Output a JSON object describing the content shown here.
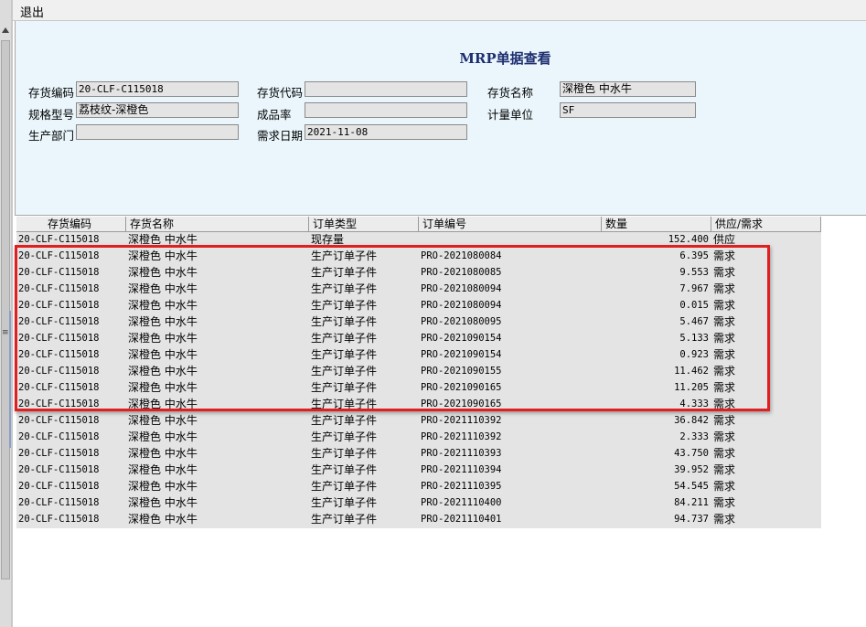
{
  "menu": {
    "exit_label": "退出"
  },
  "form": {
    "title": "MRP单据查看",
    "fields": {
      "inv_code_label": "存货编码",
      "inv_code_value": "20-CLF-C115018",
      "inv_alias_label": "存货代码",
      "inv_alias_value": "",
      "inv_name_label": "存货名称",
      "inv_name_value": "深橙色 中水牛",
      "spec_label": "规格型号",
      "spec_value": "荔枝纹-深橙色",
      "yield_label": "成品率",
      "yield_value": "",
      "unit_label": "计量单位",
      "unit_value": "SF",
      "dept_label": "生产部门",
      "dept_value": "",
      "date_label": "需求日期",
      "date_value": "2021-11-08"
    }
  },
  "grid": {
    "headers": [
      "存货编码",
      "存货名称",
      "订单类型",
      "订单编号",
      "数量",
      "供应/需求"
    ],
    "rows": [
      {
        "code": "20-CLF-C115018",
        "name": "深橙色 中水牛",
        "type": "现存量",
        "order": "",
        "qty": "152.400",
        "sd": "供应"
      },
      {
        "code": "20-CLF-C115018",
        "name": "深橙色 中水牛",
        "type": "生产订单子件",
        "order": "PRO-2021080084",
        "qty": "6.395",
        "sd": "需求"
      },
      {
        "code": "20-CLF-C115018",
        "name": "深橙色 中水牛",
        "type": "生产订单子件",
        "order": "PRO-2021080085",
        "qty": "9.553",
        "sd": "需求"
      },
      {
        "code": "20-CLF-C115018",
        "name": "深橙色 中水牛",
        "type": "生产订单子件",
        "order": "PRO-2021080094",
        "qty": "7.967",
        "sd": "需求"
      },
      {
        "code": "20-CLF-C115018",
        "name": "深橙色 中水牛",
        "type": "生产订单子件",
        "order": "PRO-2021080094",
        "qty": "0.015",
        "sd": "需求"
      },
      {
        "code": "20-CLF-C115018",
        "name": "深橙色 中水牛",
        "type": "生产订单子件",
        "order": "PRO-2021080095",
        "qty": "5.467",
        "sd": "需求"
      },
      {
        "code": "20-CLF-C115018",
        "name": "深橙色 中水牛",
        "type": "生产订单子件",
        "order": "PRO-2021090154",
        "qty": "5.133",
        "sd": "需求"
      },
      {
        "code": "20-CLF-C115018",
        "name": "深橙色 中水牛",
        "type": "生产订单子件",
        "order": "PRO-2021090154",
        "qty": "0.923",
        "sd": "需求"
      },
      {
        "code": "20-CLF-C115018",
        "name": "深橙色 中水牛",
        "type": "生产订单子件",
        "order": "PRO-2021090155",
        "qty": "11.462",
        "sd": "需求"
      },
      {
        "code": "20-CLF-C115018",
        "name": "深橙色 中水牛",
        "type": "生产订单子件",
        "order": "PRO-2021090165",
        "qty": "11.205",
        "sd": "需求"
      },
      {
        "code": "20-CLF-C115018",
        "name": "深橙色 中水牛",
        "type": "生产订单子件",
        "order": "PRO-2021090165",
        "qty": "4.333",
        "sd": "需求"
      },
      {
        "code": "20-CLF-C115018",
        "name": "深橙色 中水牛",
        "type": "生产订单子件",
        "order": "PRO-2021110392",
        "qty": "36.842",
        "sd": "需求"
      },
      {
        "code": "20-CLF-C115018",
        "name": "深橙色 中水牛",
        "type": "生产订单子件",
        "order": "PRO-2021110392",
        "qty": "2.333",
        "sd": "需求"
      },
      {
        "code": "20-CLF-C115018",
        "name": "深橙色 中水牛",
        "type": "生产订单子件",
        "order": "PRO-2021110393",
        "qty": "43.750",
        "sd": "需求"
      },
      {
        "code": "20-CLF-C115018",
        "name": "深橙色 中水牛",
        "type": "生产订单子件",
        "order": "PRO-2021110394",
        "qty": "39.952",
        "sd": "需求"
      },
      {
        "code": "20-CLF-C115018",
        "name": "深橙色 中水牛",
        "type": "生产订单子件",
        "order": "PRO-2021110395",
        "qty": "54.545",
        "sd": "需求"
      },
      {
        "code": "20-CLF-C115018",
        "name": "深橙色 中水牛",
        "type": "生产订单子件",
        "order": "PRO-2021110400",
        "qty": "84.211",
        "sd": "需求"
      },
      {
        "code": "20-CLF-C115018",
        "name": "深橙色 中水牛",
        "type": "生产订单子件",
        "order": "PRO-2021110401",
        "qty": "94.737",
        "sd": "需求"
      }
    ]
  },
  "colors": {
    "panel_bg": "#eaf6fc",
    "title_color": "#1e2f70",
    "highlight_border": "#e02020",
    "grid_row_bg": "#e4e4e4"
  },
  "icons": {
    "left_scroll_up": "arrow-up-icon",
    "left_grip": "grip-icon"
  }
}
